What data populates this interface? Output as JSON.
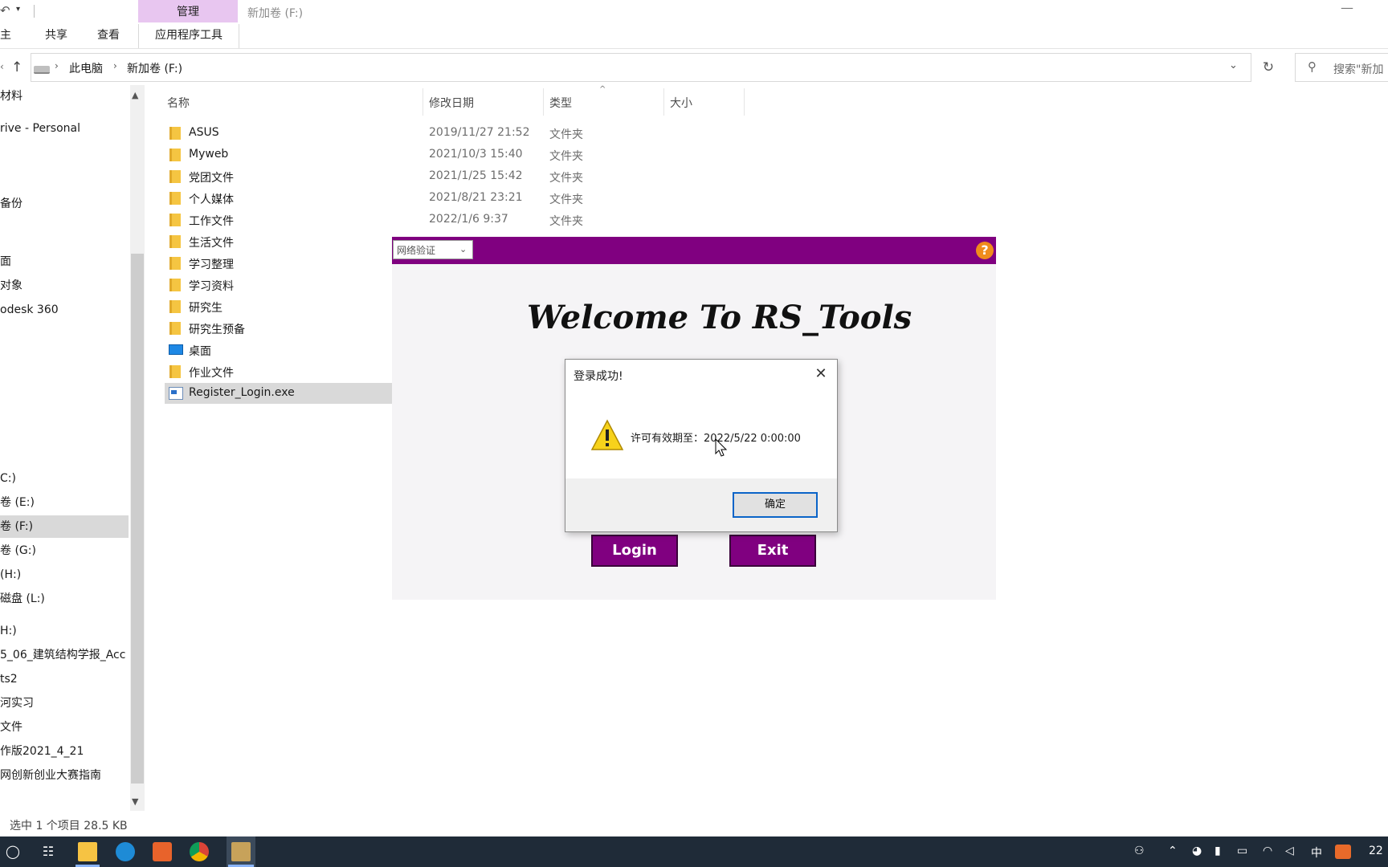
{
  "titlebar": {
    "context_tab": "管理",
    "window_title": "新加卷 (F:)",
    "minimize": "—"
  },
  "ribbon": {
    "tabs": [
      "主页",
      "共享",
      "查看",
      "应用程序工具"
    ],
    "tab_home_visible": "主页"
  },
  "address": {
    "crumbs": [
      "此电脑",
      "新加卷 (F:)"
    ],
    "search_placeholder": "搜索\"新加"
  },
  "nav_pane": {
    "items": [
      {
        "label": "材料"
      },
      {
        "label": "rive - Personal"
      },
      {
        "label": "备份"
      },
      {
        "label": "面"
      },
      {
        "label": "对象"
      },
      {
        "label": "odesk 360"
      },
      {
        "label": "C:)"
      },
      {
        "label": "卷 (E:)"
      },
      {
        "label": "卷 (F:)"
      },
      {
        "label": "卷 (G:)"
      },
      {
        "label": "(H:)"
      },
      {
        "label": "磁盘 (L:)"
      },
      {
        "label": "H:)"
      },
      {
        "label": "5_06_建筑结构学报_Acc"
      },
      {
        "label": "ts2"
      },
      {
        "label": "河实习"
      },
      {
        "label": "文件"
      },
      {
        "label": "作版2021_4_21"
      },
      {
        "label": "网创新创业大赛指南"
      }
    ]
  },
  "file_list": {
    "columns": {
      "name": "名称",
      "modified": "修改日期",
      "type": "类型",
      "size": "大小"
    },
    "rows": [
      {
        "name": "ASUS",
        "modified": "2019/11/27 21:52",
        "type": "文件夹"
      },
      {
        "name": "Myweb",
        "modified": "2021/10/3 15:40",
        "type": "文件夹"
      },
      {
        "name": "党团文件",
        "modified": "2021/1/25 15:42",
        "type": "文件夹"
      },
      {
        "name": "个人媒体",
        "modified": "2021/8/21 23:21",
        "type": "文件夹"
      },
      {
        "name": "工作文件",
        "modified": "2022/1/6 9:37",
        "type": "文件夹"
      },
      {
        "name": "生活文件",
        "modified": "",
        "type": ""
      },
      {
        "name": "学习整理",
        "modified": "",
        "type": ""
      },
      {
        "name": "学习资料",
        "modified": "",
        "type": ""
      },
      {
        "name": "研究生",
        "modified": "",
        "type": ""
      },
      {
        "name": "研究生预备",
        "modified": "",
        "type": ""
      },
      {
        "name": "桌面",
        "modified": "",
        "type": ""
      },
      {
        "name": "作业文件",
        "modified": "",
        "type": ""
      },
      {
        "name": "Register_Login.exe",
        "modified": "",
        "type": ""
      }
    ]
  },
  "statusbar": {
    "text": "选中 1 个项目  28.5 KB"
  },
  "rs_tools": {
    "combo_value": "网络验证",
    "help": "?",
    "welcome": "Welcome To RS_Tools",
    "login_label": "Login",
    "exit_label": "Exit",
    "accent_color": "#800080"
  },
  "message_box": {
    "title": "登录成功!",
    "body": "许可有效期至：2022/5/22 0:00:00",
    "ok_label": "确定"
  },
  "taskbar": {
    "tray_ime": "中",
    "clock_partial": "22"
  }
}
